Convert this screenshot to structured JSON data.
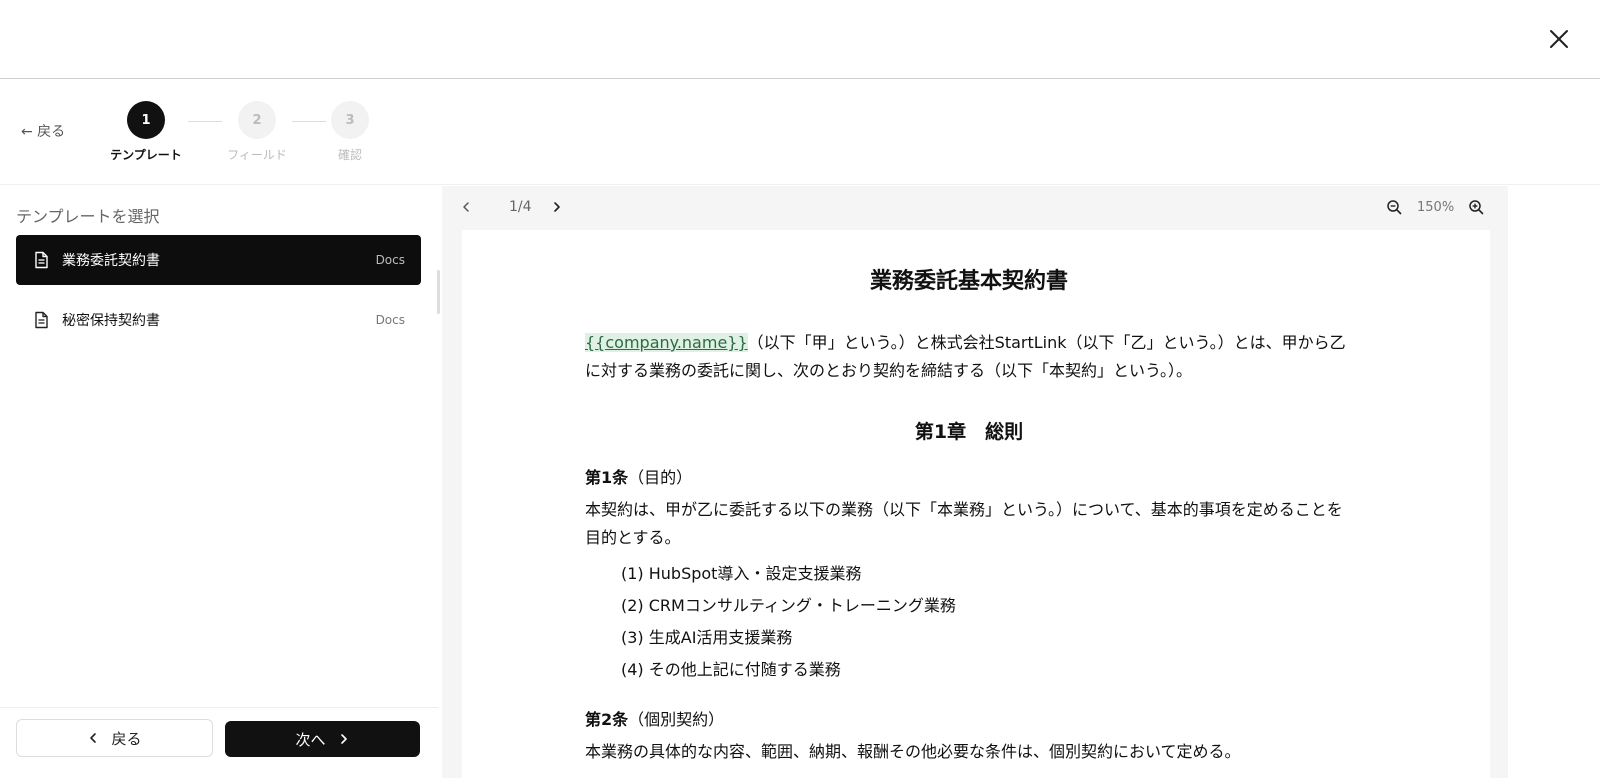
{
  "header": {
    "close_icon": "close-icon"
  },
  "stepper": {
    "back_label": "← 戻る",
    "steps": [
      {
        "number": "1",
        "label": "テンプレート",
        "state": "active"
      },
      {
        "number": "2",
        "label": "フィールド",
        "state": "inactive"
      },
      {
        "number": "3",
        "label": "確認",
        "state": "inactive"
      }
    ]
  },
  "sidebar": {
    "title": "テンプレートを選択",
    "templates": [
      {
        "name": "業務委託契約書",
        "badge": "Docs",
        "selected": true,
        "icon": "document-icon"
      },
      {
        "name": "秘密保持契約書",
        "badge": "Docs",
        "selected": false,
        "icon": "document-icon"
      }
    ],
    "back_button": "戻る",
    "next_button": "次へ"
  },
  "preview": {
    "page_indicator": "1/4",
    "zoom_level": "150%",
    "document": {
      "title": "業務委託基本契約書",
      "placeholder": "{{company.name}}",
      "intro_rest": "（以下「甲」という。）と株式会社StartLink（以下「乙」という。）とは、甲から乙に対する業務の委託に関し、次のとおり契約を締結する（以下「本契約」という。）。",
      "chapter": "第1章　総則",
      "article1_heading": "第1条",
      "article1_paren": "（目的）",
      "article1_body": "本契約は、甲が乙に委託する以下の業務（以下「本業務」という。）について、基本的事項を定めることを目的とする。",
      "items": [
        "(1) HubSpot導入・設定支援業務",
        "(2) CRMコンサルティング・トレーニング業務",
        "(3) 生成AI活用支援業務",
        "(4) その他上記に付随する業務"
      ],
      "article2_heading": "第2条",
      "article2_paren": "（個別契約）",
      "article2_body": "本業務の具体的な内容、範囲、納期、報酬その他必要な条件は、個別契約において定める。"
    }
  },
  "colors": {
    "primary": "#111111",
    "placeholder_bg": "#dff0e4",
    "placeholder_text": "#2e6b44"
  }
}
